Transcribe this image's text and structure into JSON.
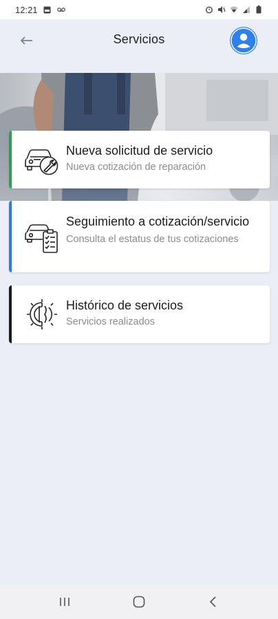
{
  "status_bar": {
    "time": "12:21",
    "icons": [
      "gallery-icon",
      "voicemail-icon",
      "alarm-icon",
      "mute-icon",
      "wifi-icon",
      "signal-icon",
      "battery-icon"
    ]
  },
  "header": {
    "title": "Servicios",
    "back_icon": "arrow-left-icon",
    "avatar_icon": "user-icon",
    "avatar_color": "#2f80ed"
  },
  "cards": [
    {
      "title": "Nueva solicitud de servicio",
      "subtitle": "Nueva cotización de reparación",
      "icon": "car-wrench-icon",
      "accent": "#2e9e55"
    },
    {
      "title": "Seguimiento a cotización/servicio",
      "subtitle": "Consulta el estatus de tus cotizaciones",
      "icon": "car-checklist-icon",
      "accent": "#2f7ae5"
    },
    {
      "title": "Histórico de servicios",
      "subtitle": "Servicios realizados",
      "icon": "gear-history-icon",
      "accent": "#1a1a1a"
    }
  ],
  "nav_bar": {
    "icons": [
      "recent-apps-icon",
      "home-icon",
      "back-icon"
    ]
  }
}
